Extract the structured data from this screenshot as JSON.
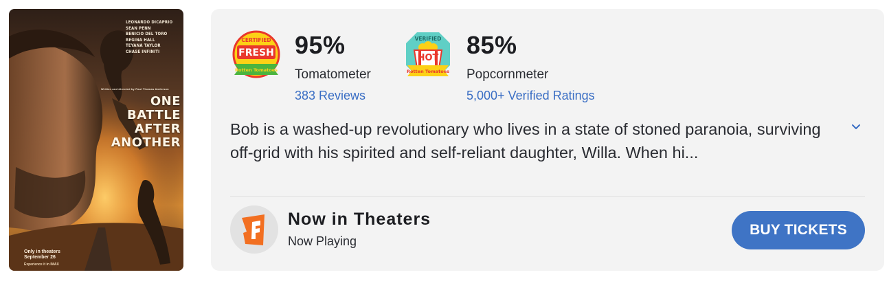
{
  "poster": {
    "cast": [
      "Leonardo DiCaprio",
      "Sean Penn",
      "Benicio Del Toro",
      "Regina Hall",
      "Teyana Taylor",
      "Chase Infiniti"
    ],
    "credit": "Written and directed by Paul Thomas Anderson",
    "title_lines": [
      "ONE",
      "BATTLE",
      "AFTER",
      "ANOTHER"
    ],
    "release": [
      "Only in theaters",
      "September 26"
    ],
    "formats": "Experience it in IMAX"
  },
  "critics": {
    "icon": "certified-fresh-icon",
    "badge_top": "CERTIFIED",
    "badge_main": "FRESH",
    "badge_brand": "Rotten Tomatoes",
    "score": "95%",
    "label": "Tomatometer",
    "link": "383 Reviews"
  },
  "audience": {
    "icon": "verified-hot-icon",
    "badge_top": "VERIFIED",
    "badge_main": "HOT",
    "badge_brand": "Rotten Tomatoes",
    "score": "85%",
    "label": "Popcornmeter",
    "link": "5,000+ Verified Ratings"
  },
  "synopsis": "Bob is a washed-up revolutionary who lives in a state of stoned paranoia, surviving off-grid with his spirited and self-reliant daughter, Willa. When hi...",
  "expand_icon": "chevron-down-icon",
  "theater": {
    "logo_icon": "fandango-icon",
    "title": "Now in Theaters",
    "subtitle": "Now Playing"
  },
  "buy_button": "BUY TICKETS",
  "colors": {
    "card_bg": "#f3f3f3",
    "link": "#3a6ec4",
    "button": "#3f74c5",
    "fandango": "#f26f21",
    "fresh_red": "#e9372c",
    "fresh_yellow": "#fcd116",
    "fresh_green": "#4bb43f",
    "hot_teal": "#5fcfc5"
  }
}
